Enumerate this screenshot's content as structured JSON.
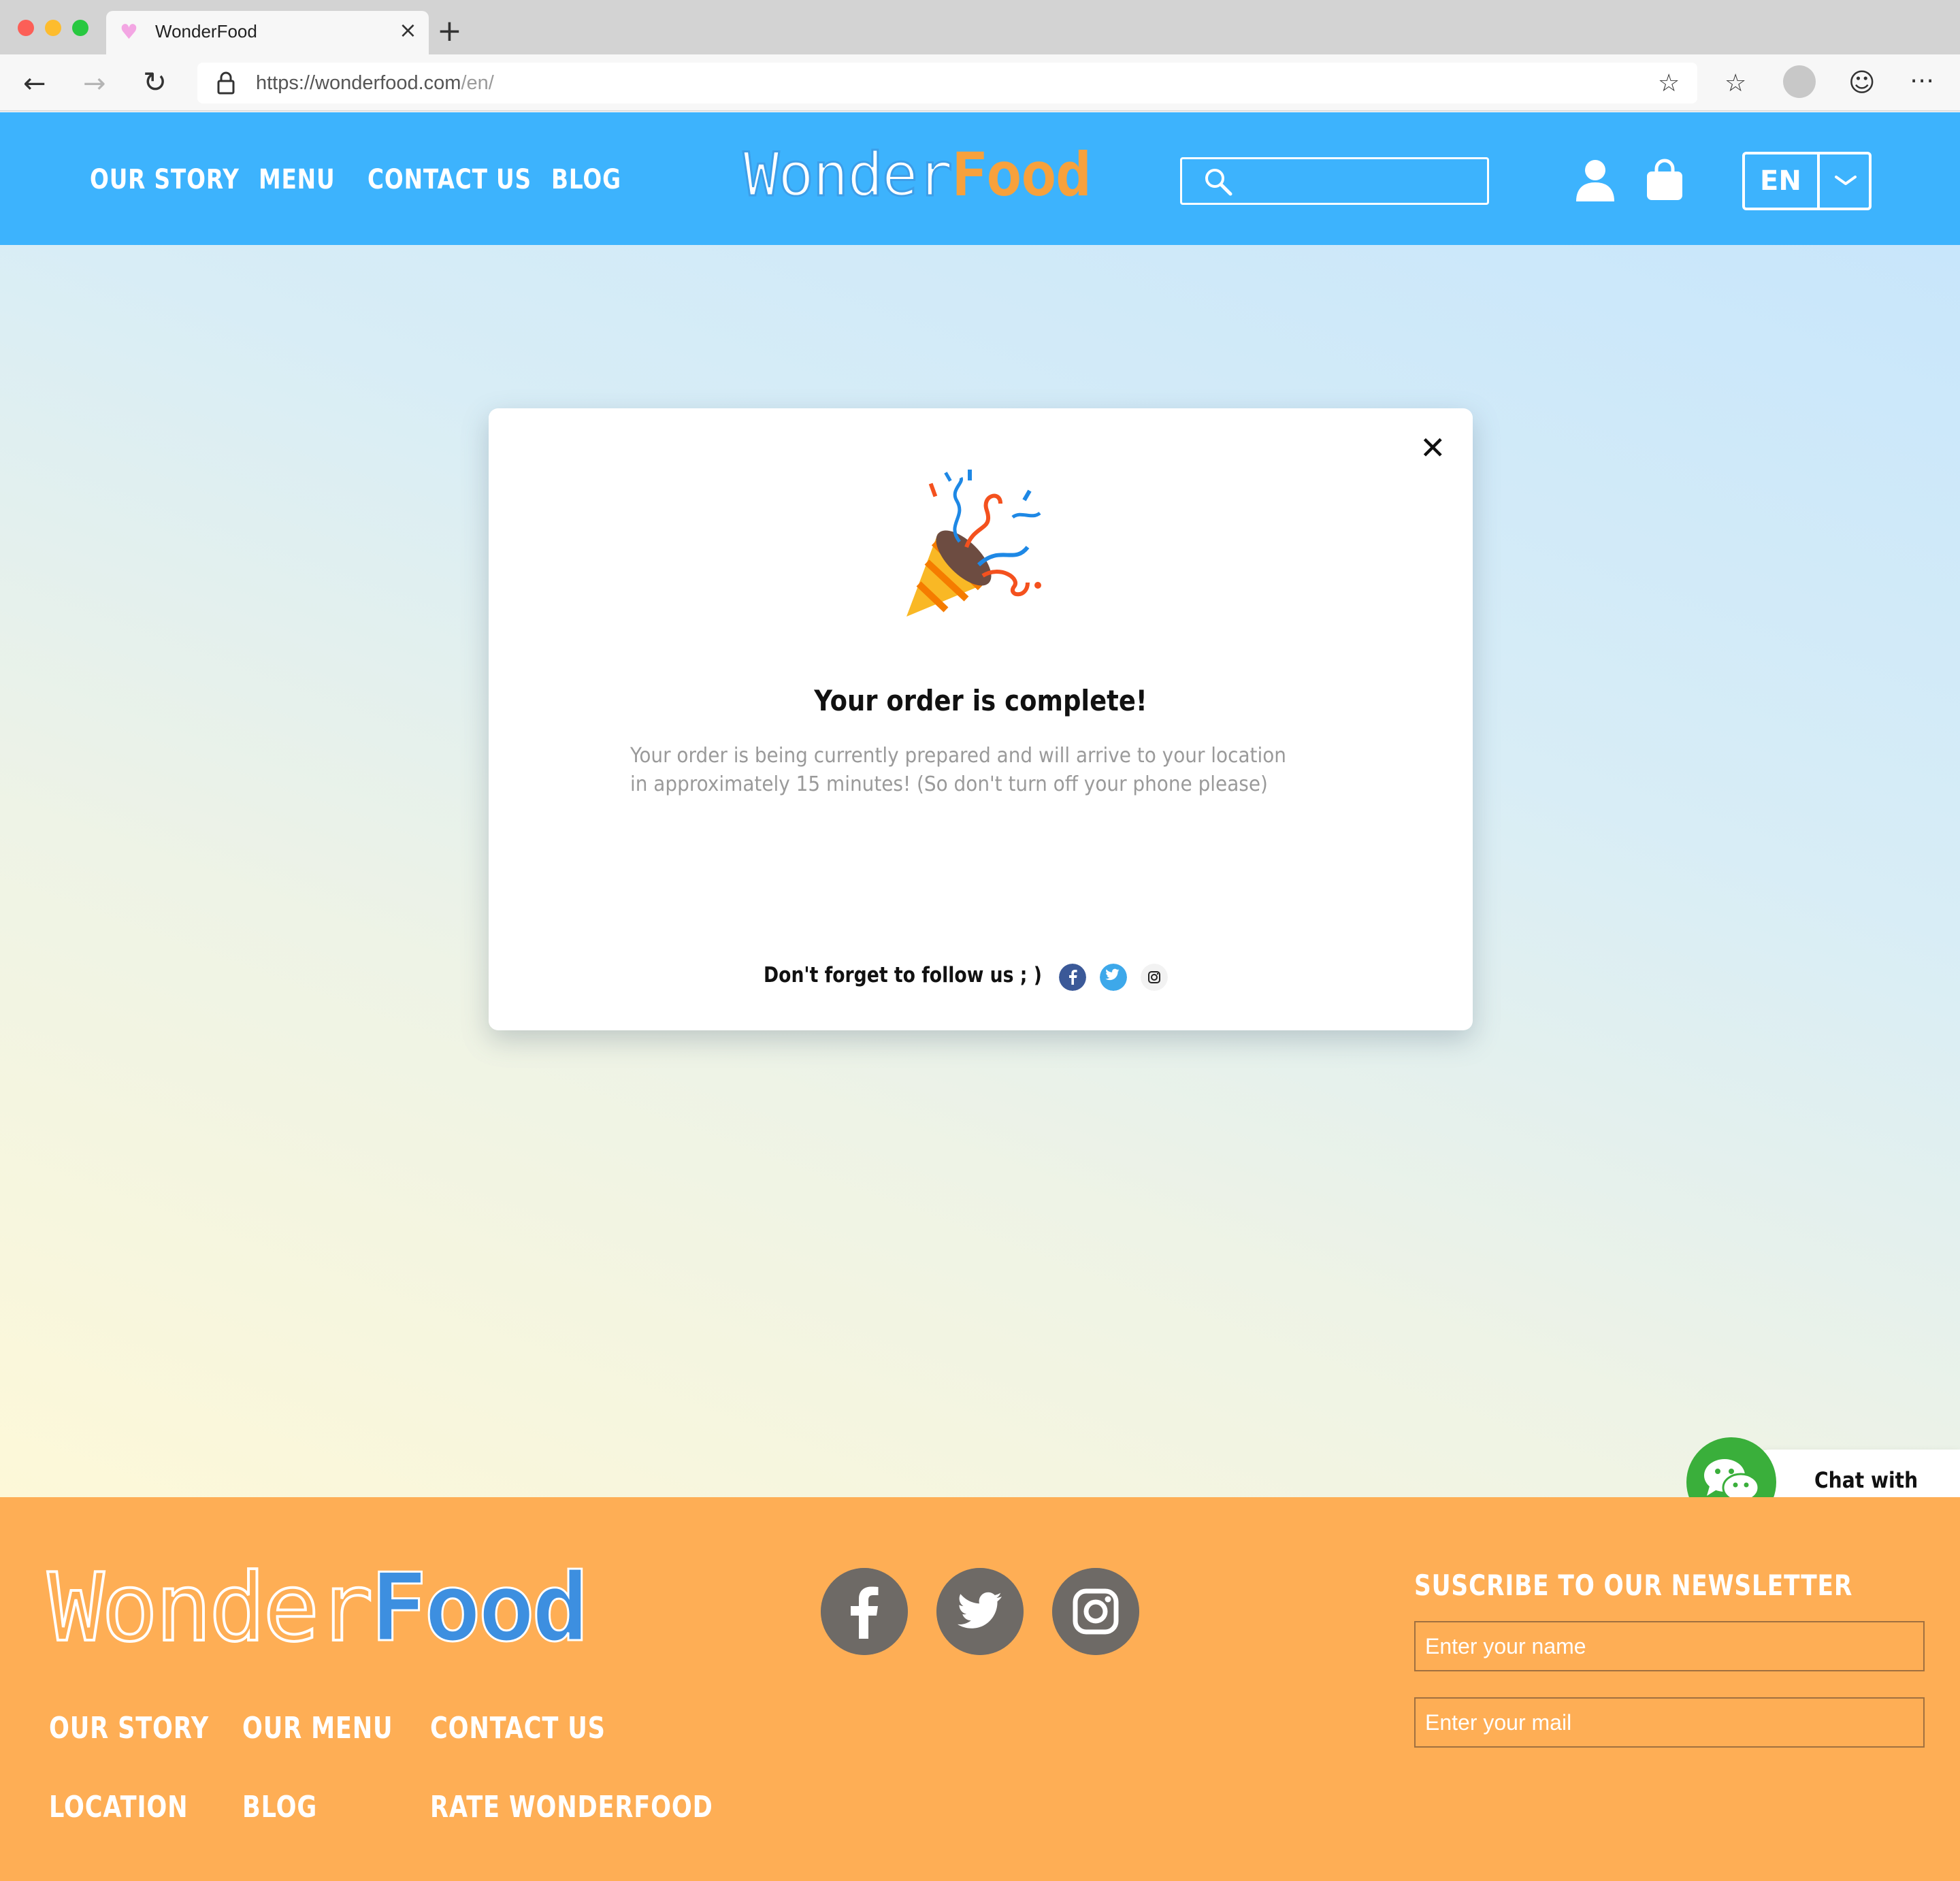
{
  "browser": {
    "tab_title": "WonderFood",
    "url_host": "https://wonderfood.com",
    "url_path": "/en/"
  },
  "header": {
    "nav": [
      "OUR STORY",
      "MENU",
      "CONTACT US",
      "BLOG"
    ],
    "logo_part1": "Wonder",
    "logo_part2": "Food",
    "language": "EN"
  },
  "modal": {
    "title": "Your order is complete!",
    "body_line1": "Your order is being currently prepared and will arrive to your location",
    "body_line2": "in approximately 15 minutes! (So don't turn off your phone please)",
    "follow_text": "Don't forget to follow us ; )",
    "close_symbol": "✕"
  },
  "chat": {
    "label": "Chat with us!"
  },
  "footer": {
    "logo_part1": "Wonder",
    "logo_part2": "Food",
    "nav_row1": [
      "OUR STORY",
      "OUR MENU",
      "CONTACT US"
    ],
    "nav_row2": [
      "LOCATION",
      "BLOG",
      "RATE WONDERFOOD"
    ],
    "newsletter_title": "SUSCRIBE TO OUR NEWSLETTER",
    "name_placeholder": "Enter your name",
    "mail_placeholder": "Enter your mail"
  },
  "colors": {
    "header_blue": "#3db3fd",
    "footer_orange": "#feae55",
    "logo_orange": "#f7a13c",
    "logo_blue": "#3d8fe0",
    "chat_green": "#3aaf3b"
  },
  "icons": [
    "back-arrow-icon",
    "forward-arrow-icon",
    "reload-icon",
    "lock-icon",
    "star-icon",
    "favorites-icon",
    "profile-icon",
    "emoji-icon",
    "more-icon",
    "search-icon",
    "user-icon",
    "shopping-bag-icon",
    "chevron-down-icon",
    "close-icon",
    "party-popper-icon",
    "facebook-icon",
    "twitter-icon",
    "instagram-icon",
    "wechat-icon"
  ]
}
